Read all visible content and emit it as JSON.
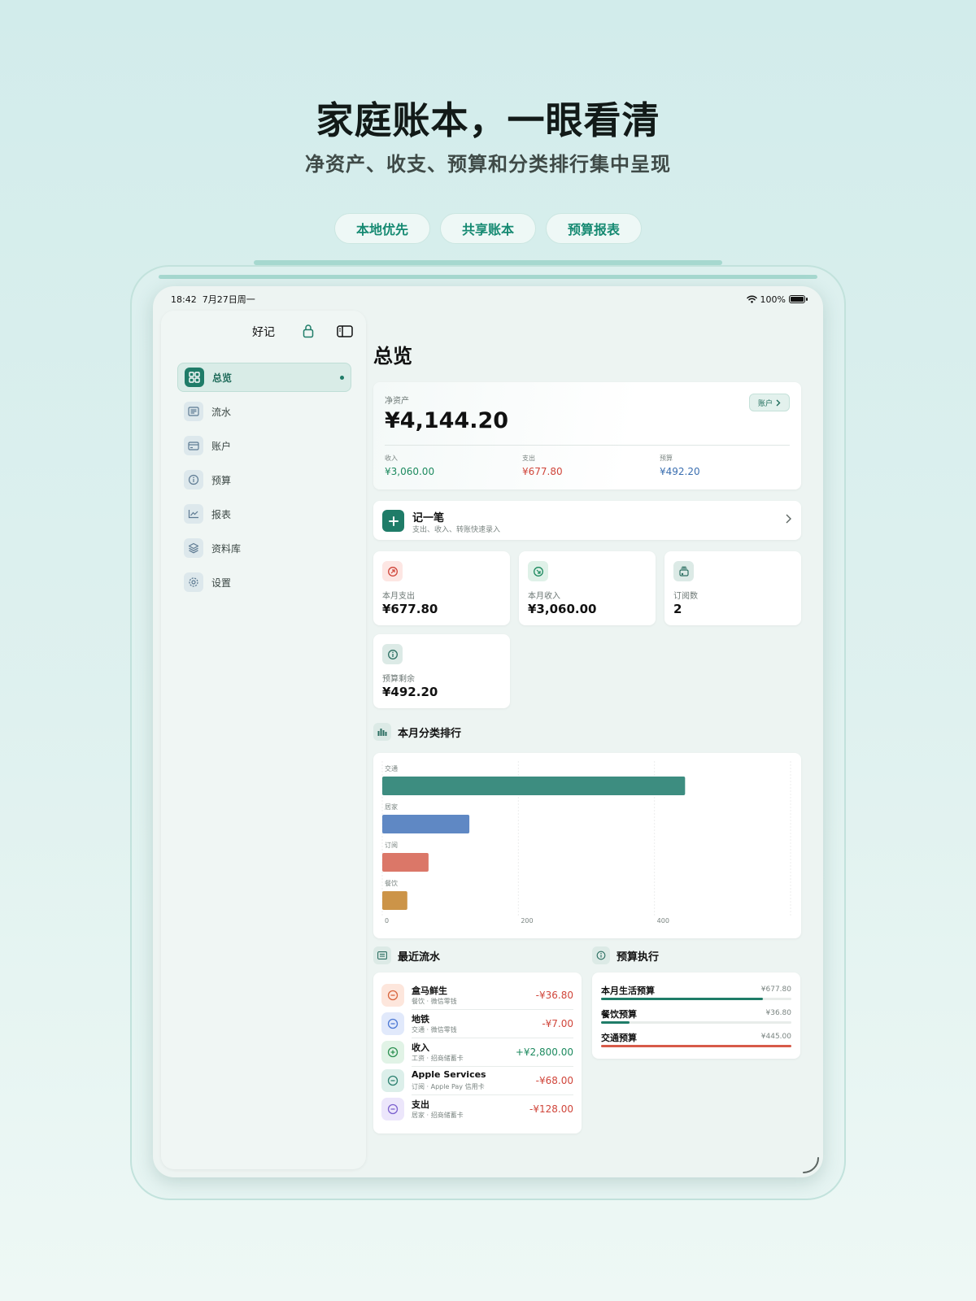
{
  "hero": {
    "title": "家庭账本，一眼看清",
    "subtitle": "净资产、收支、预算和分类排行集中呈现",
    "pills": [
      "本地优先",
      "共享账本",
      "预算报表"
    ]
  },
  "status_bar": {
    "time": "18:42",
    "date": "7月27日周一",
    "battery": "100%"
  },
  "sidebar": {
    "app_name": "好记",
    "items": [
      {
        "label": "总览",
        "icon": "grid-icon",
        "active": true
      },
      {
        "label": "流水",
        "icon": "list-icon"
      },
      {
        "label": "账户",
        "icon": "card-icon"
      },
      {
        "label": "预算",
        "icon": "gauge-icon"
      },
      {
        "label": "报表",
        "icon": "line-chart-icon"
      },
      {
        "label": "资料库",
        "icon": "layers-icon"
      },
      {
        "label": "设置",
        "icon": "gear-icon"
      }
    ]
  },
  "overview": {
    "title": "总览",
    "net_worth": {
      "label": "净资产",
      "value": "¥4,144.20",
      "accounts_button": "账户",
      "income_label": "收入",
      "income_value": "¥3,060.00",
      "expense_label": "支出",
      "expense_value": "¥677.80",
      "budget_label": "预算",
      "budget_value": "¥492.20"
    },
    "quick_entry": {
      "title": "记一笔",
      "subtitle": "支出、收入、转账快速录入"
    },
    "stats": [
      {
        "label": "本月支出",
        "value": "¥677.80",
        "icon": "expense-arrow-icon"
      },
      {
        "label": "本月收入",
        "value": "¥3,060.00",
        "icon": "income-arrow-icon"
      },
      {
        "label": "订阅数",
        "value": "2",
        "icon": "subscription-icon"
      },
      {
        "label": "预算剩余",
        "value": "¥492.20",
        "icon": "gauge-icon"
      }
    ],
    "ranking_title": "本月分类排行",
    "recent_title": "最近流水",
    "budget_title": "预算执行"
  },
  "chart_data": {
    "type": "bar",
    "orientation": "horizontal",
    "categories": [
      "交通",
      "居家",
      "订阅",
      "餐饮"
    ],
    "values": [
      445,
      128,
      68,
      36.8
    ],
    "colors": [
      "#3d8d80",
      "#5f88c4",
      "#db7768",
      "#cc9448"
    ],
    "xlim": [
      0,
      600
    ],
    "xticks": [
      0,
      200,
      400
    ],
    "grid": true
  },
  "transactions": [
    {
      "title": "盒马鲜生",
      "sub": "餐饮 · 微信零钱",
      "amount": "-¥36.80",
      "kind": "expense",
      "tint": "#fde6dc",
      "stroke": "#d9663f"
    },
    {
      "title": "地铁",
      "sub": "交通 · 微信零钱",
      "amount": "-¥7.00",
      "kind": "expense",
      "tint": "#e1e9fb",
      "stroke": "#4d79d4"
    },
    {
      "title": "收入",
      "sub": "工资 · 招商储蓄卡",
      "amount": "+¥2,800.00",
      "kind": "income",
      "tint": "#e1f3e6",
      "stroke": "#2f9254"
    },
    {
      "title": "Apple Services",
      "sub": "订阅 · Apple Pay 信用卡",
      "amount": "-¥68.00",
      "kind": "expense",
      "tint": "#dcefea",
      "stroke": "#2c8170"
    },
    {
      "title": "支出",
      "sub": "居家 · 招商储蓄卡",
      "amount": "-¥128.00",
      "kind": "expense",
      "tint": "#ece6fb",
      "stroke": "#7d62cf"
    }
  ],
  "budgets": [
    {
      "name": "本月生活预算",
      "amount": "¥677.80",
      "progress": 0.85,
      "color": "#1f7c68"
    },
    {
      "name": "餐饮预算",
      "amount": "¥36.80",
      "progress": 0.15,
      "color": "#1f7c68"
    },
    {
      "name": "交通预算",
      "amount": "¥445.00",
      "progress": 1.0,
      "color": "#d75b49"
    }
  ]
}
